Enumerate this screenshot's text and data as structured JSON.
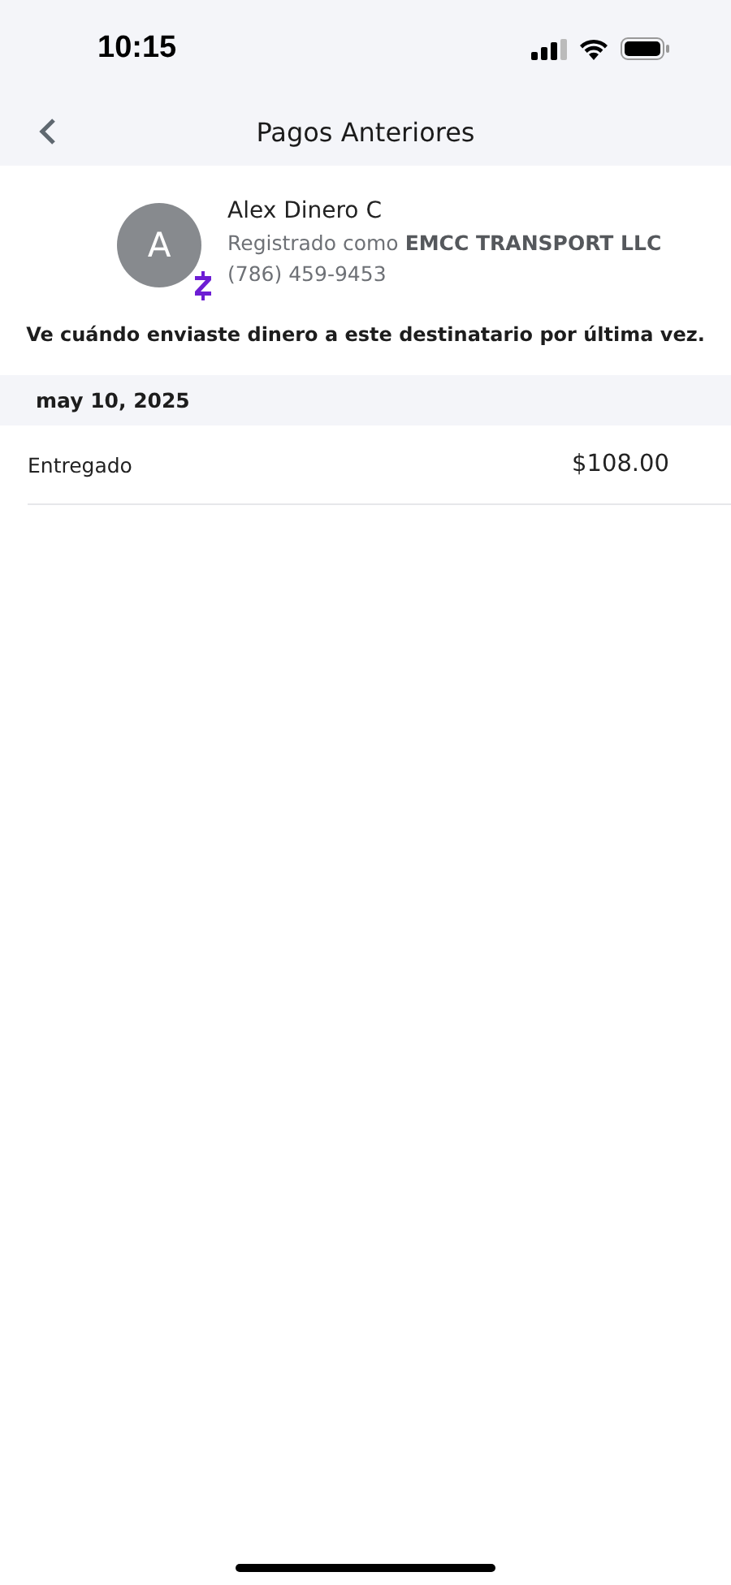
{
  "status_bar": {
    "time": "10:15"
  },
  "nav": {
    "title": "Pagos Anteriores"
  },
  "recipient": {
    "initial": "A",
    "name": "Alex Dinero C",
    "registered": "Registrado como **EMCC TRANSPORT LLC**",
    "phone": "(786) 459-9453"
  },
  "message": "Ve cuándo enviaste dinero a este destinatario por última vez.",
  "payments": [
    {
      "date": "may 10, 2025",
      "status": "Entregado",
      "amount": "$108.00"
    }
  ]
}
